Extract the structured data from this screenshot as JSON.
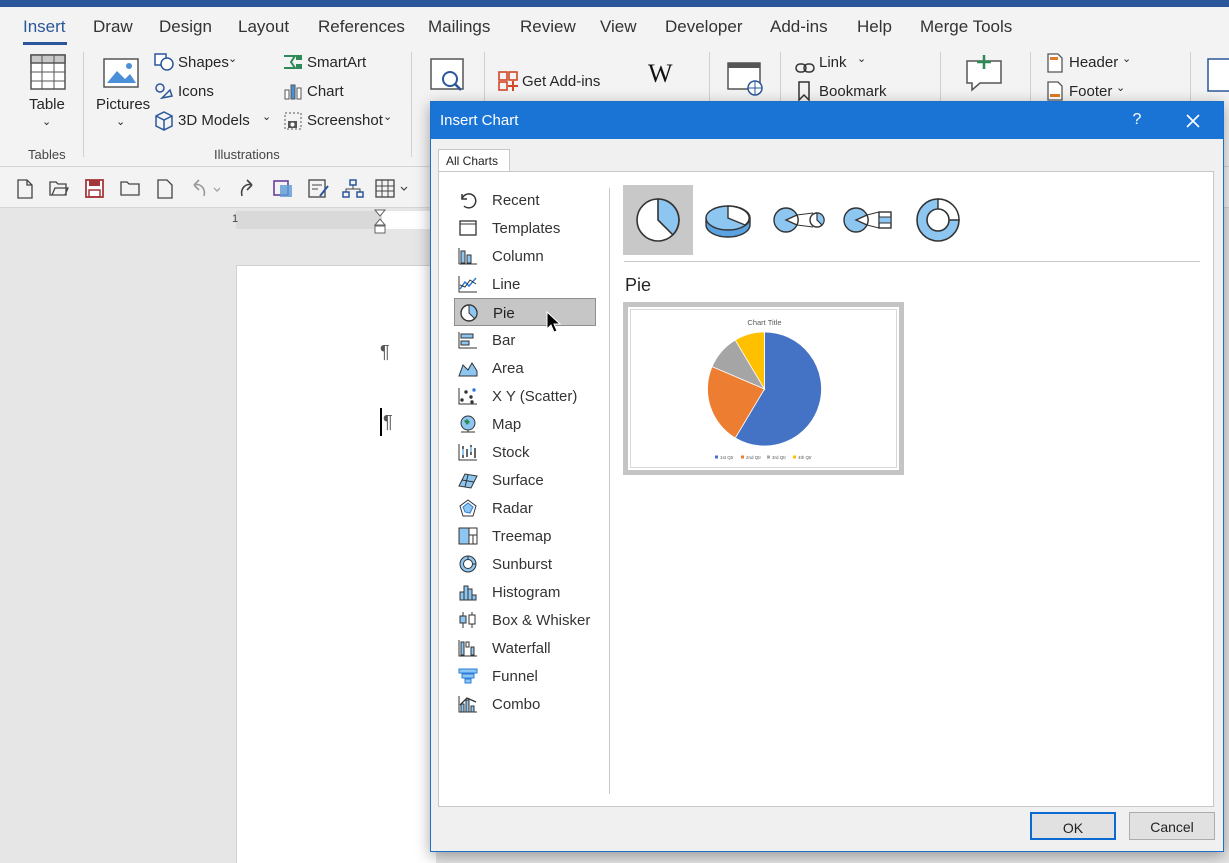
{
  "ribbon": {
    "tabs": [
      "Insert",
      "Draw",
      "Design",
      "Layout",
      "References",
      "Mailings",
      "Review",
      "View",
      "Developer",
      "Add-ins",
      "Help",
      "Merge Tools"
    ],
    "active_tab": "Insert",
    "table_label": "Table",
    "tables_group": "Tables",
    "pictures_label": "Pictures",
    "shapes_label": "Shapes",
    "icons_label": "Icons",
    "models_label": "3D Models",
    "smartart_label": "SmartArt",
    "chart_label": "Chart",
    "screenshot_label": "Screenshot",
    "illustrations_group": "Illustrations",
    "addins_label": "Get Add-ins",
    "link_label": "Link",
    "bookmark_label": "Bookmark",
    "header_label": "Header",
    "footer_label": "Footer"
  },
  "document": {
    "pilcrow": "¶"
  },
  "dialog": {
    "title": "Insert Chart",
    "help": "?",
    "tab": "All Charts",
    "categories": [
      "Recent",
      "Templates",
      "Column",
      "Line",
      "Pie",
      "Bar",
      "Area",
      "X Y (Scatter)",
      "Map",
      "Stock",
      "Surface",
      "Radar",
      "Treemap",
      "Sunburst",
      "Histogram",
      "Box & Whisker",
      "Waterfall",
      "Funnel",
      "Combo"
    ],
    "selected_category": "Pie",
    "subtypes": [
      "pie-icon",
      "3d-pie-icon",
      "pie-of-pie-icon",
      "bar-of-pie-icon",
      "doughnut-icon"
    ],
    "selected_subtype": "pie-icon",
    "subtype_title": "Pie",
    "ok_label": "OK",
    "cancel_label": "Cancel"
  },
  "chart_data": {
    "type": "pie",
    "title": "Chart Title",
    "categories": [
      "1st Qtr",
      "2nd Qtr",
      "3rd Qtr",
      "4th Qtr"
    ],
    "values": [
      8.2,
      3.2,
      1.4,
      1.2
    ],
    "colors": [
      "#4472c4",
      "#ed7d31",
      "#a5a5a5",
      "#ffc000"
    ],
    "legend": "bottom"
  }
}
